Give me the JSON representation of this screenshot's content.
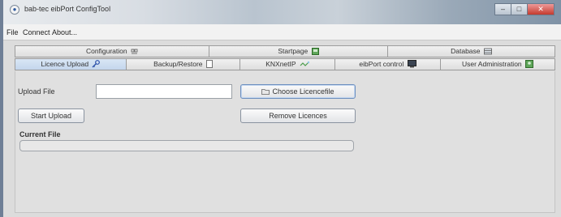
{
  "window": {
    "title": "bab-tec eibPort ConfigTool",
    "controls": {
      "minimize": "–",
      "maximize": "□",
      "close": "✕"
    }
  },
  "menu": [
    "File",
    "Connect",
    "About..."
  ],
  "tabs_row1": [
    {
      "label": "Configuration",
      "icon": "configuration-icon"
    },
    {
      "label": "Startpage",
      "icon": "startpage-icon"
    },
    {
      "label": "Database",
      "icon": "database-icon"
    }
  ],
  "tabs_row2": [
    {
      "label": "Licence Upload",
      "icon": "key-icon",
      "active": true
    },
    {
      "label": "Backup/Restore",
      "icon": "backup-icon"
    },
    {
      "label": "KNXnetIP",
      "icon": "network-icon"
    },
    {
      "label": "eibPort control",
      "icon": "monitor-icon"
    },
    {
      "label": "User Administration",
      "icon": "users-icon"
    }
  ],
  "licence_panel": {
    "upload_file_label": "Upload File",
    "upload_file_value": "",
    "choose_button": "Choose Licencefile",
    "start_upload_button": "Start Upload",
    "remove_button": "Remove Licences",
    "current_file_label": "Current File",
    "current_file_value": ""
  },
  "colors": {
    "accent": "#c4d6ec",
    "close": "#c43a2e",
    "panel": "#e0e0e0"
  }
}
